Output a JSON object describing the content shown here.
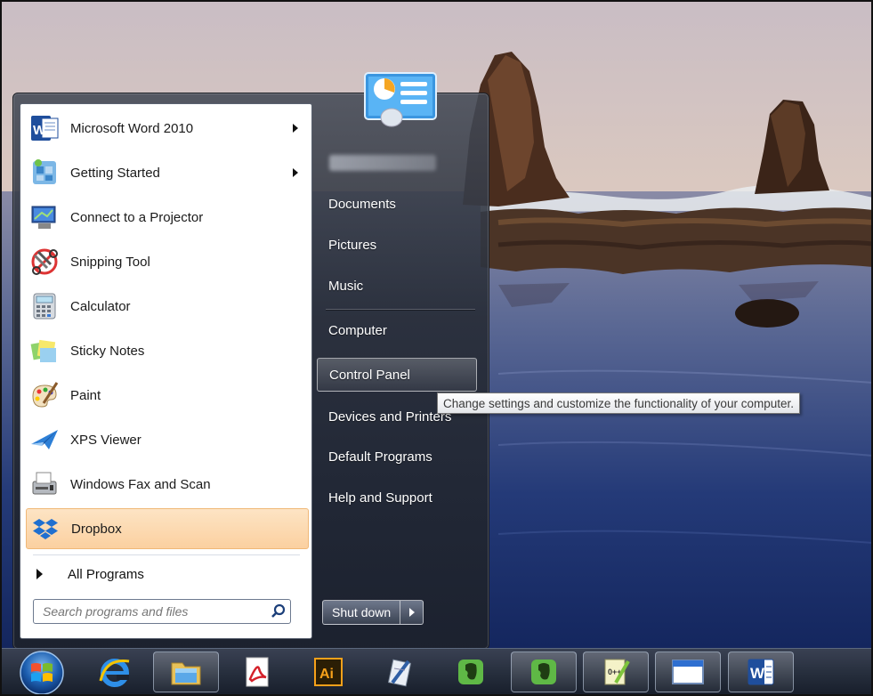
{
  "programs": [
    {
      "label": "Microsoft Word 2010",
      "has_submenu": true,
      "icon": "word-icon"
    },
    {
      "label": "Getting Started",
      "has_submenu": true,
      "icon": "getting-started-icon"
    },
    {
      "label": "Connect to a Projector",
      "has_submenu": false,
      "icon": "projector-icon"
    },
    {
      "label": "Snipping Tool",
      "has_submenu": false,
      "icon": "scissors-icon"
    },
    {
      "label": "Calculator",
      "has_submenu": false,
      "icon": "calculator-icon"
    },
    {
      "label": "Sticky Notes",
      "has_submenu": false,
      "icon": "sticky-notes-icon"
    },
    {
      "label": "Paint",
      "has_submenu": false,
      "icon": "paint-palette-icon"
    },
    {
      "label": "XPS Viewer",
      "has_submenu": false,
      "icon": "xps-viewer-icon"
    },
    {
      "label": "Windows Fax and Scan",
      "has_submenu": false,
      "icon": "fax-scan-icon"
    },
    {
      "label": "Dropbox",
      "has_submenu": false,
      "icon": "dropbox-icon",
      "highlighted": true
    }
  ],
  "all_programs_label": "All Programs",
  "search": {
    "placeholder": "Search programs and files"
  },
  "right_links": [
    {
      "label": "Documents"
    },
    {
      "label": "Pictures"
    },
    {
      "label": "Music"
    },
    {
      "label": "Computer"
    },
    {
      "label": "Control Panel"
    },
    {
      "label": "Devices and Printers"
    },
    {
      "label": "Default Programs"
    },
    {
      "label": "Help and Support"
    }
  ],
  "shutdown_label": "Shut down",
  "tooltip": "Change settings and customize the functionality of your computer.",
  "taskbar": [
    {
      "name": "internet-explorer",
      "icon": "internet-explorer-icon",
      "active": false
    },
    {
      "name": "windows-explorer",
      "icon": "folder-icon",
      "active": true
    },
    {
      "name": "adobe-reader",
      "icon": "acrobat-icon",
      "active": false
    },
    {
      "name": "illustrator",
      "icon": "illustrator-icon",
      "active": false
    },
    {
      "name": "pen-tool",
      "icon": "pen-notepad-icon",
      "active": false
    },
    {
      "name": "evernote",
      "icon": "evernote-icon",
      "active": false
    },
    {
      "name": "evernote-2",
      "icon": "evernote-icon",
      "active": true
    },
    {
      "name": "notepad-plus",
      "icon": "notepad-plus-icon",
      "active": true
    },
    {
      "name": "window",
      "icon": "window-icon",
      "active": true
    },
    {
      "name": "word",
      "icon": "word-icon",
      "active": true
    }
  ],
  "taskbar_icon_text": {
    "illustrator": "Ai",
    "word": "W",
    "notepad_plus": "0++"
  },
  "colors": {
    "highlight": "#fbd0a0",
    "tooltip_border": "#767676",
    "taskbar": "#1c2330"
  }
}
